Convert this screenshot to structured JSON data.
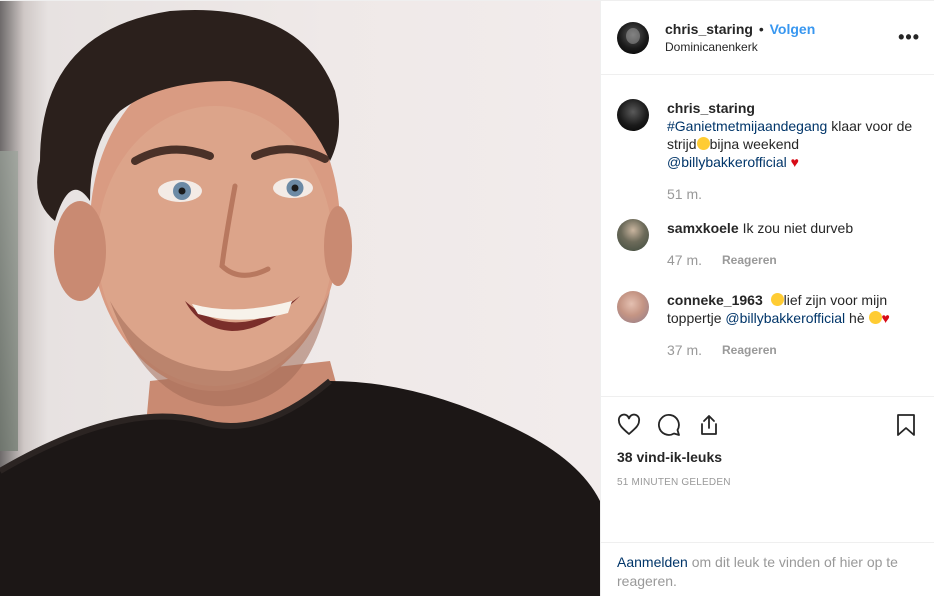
{
  "header": {
    "username": "chris_staring",
    "separator": "•",
    "follow_label": "Volgen",
    "location": "Dominicanenkerk",
    "more_label": "•••"
  },
  "caption": {
    "username": "chris_staring",
    "hashtag": "#Ganietmetmijaandegang",
    "text_1": " klaar voor de strijd",
    "text_2": "bijna weekend",
    "mention": "@billybakkerofficial",
    "heart": "♥",
    "time": "51 m."
  },
  "comments": [
    {
      "username": "samxkoele",
      "text": "Ik zou niet durveb",
      "time": "47 m.",
      "reply_label": "Reageren"
    },
    {
      "username": "conneke_1963",
      "text_1": "lief zijn voor mijn toppertje ",
      "mention": "@billybakkerofficial",
      "text_2": " hè ",
      "heart": "♥",
      "time": "37 m.",
      "reply_label": "Reageren"
    }
  ],
  "actions": {
    "like_icon": "heart-icon",
    "comment_icon": "comment-icon",
    "share_icon": "share-icon",
    "save_icon": "bookmark-icon",
    "likes": "38 vind-ik-leuks",
    "timestamp": "51 MINUTEN GELEDEN"
  },
  "login": {
    "link": "Aanmelden",
    "text": " om dit leuk te vinden of hier op te reageren."
  },
  "colors": {
    "follow": "#3897f0",
    "link": "#003569",
    "muted": "#999999",
    "heart": "#d70a16"
  }
}
